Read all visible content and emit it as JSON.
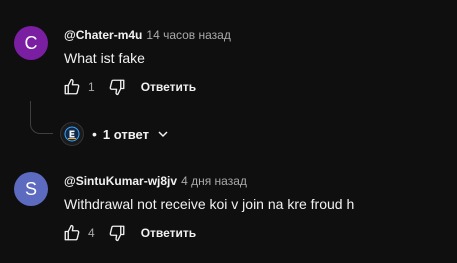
{
  "comments": [
    {
      "avatar_letter": "C",
      "avatar_color": "#7b1fa2",
      "author": "@Chater-m4u",
      "time": "14 часов назад",
      "text": "What ist fake",
      "likes": "1",
      "reply_label": "Ответить",
      "replies_toggle": {
        "bullet": "•",
        "label": "1 ответ"
      }
    },
    {
      "avatar_letter": "S",
      "avatar_color": "#5c6bc0",
      "author": "@SintuKumar-wj8jv",
      "time": "4 дня назад",
      "text": "Withdrawal not receive koi v join na kre froud h",
      "likes": "4",
      "reply_label": "Ответить"
    }
  ],
  "icons": {
    "like": "thumbs-up-icon",
    "dislike": "thumbs-down-icon",
    "chevron": "chevron-down-icon"
  },
  "colors": {
    "background": "#0f0f0f",
    "text_primary": "#f1f1f1",
    "text_secondary": "#aaaaaa"
  }
}
